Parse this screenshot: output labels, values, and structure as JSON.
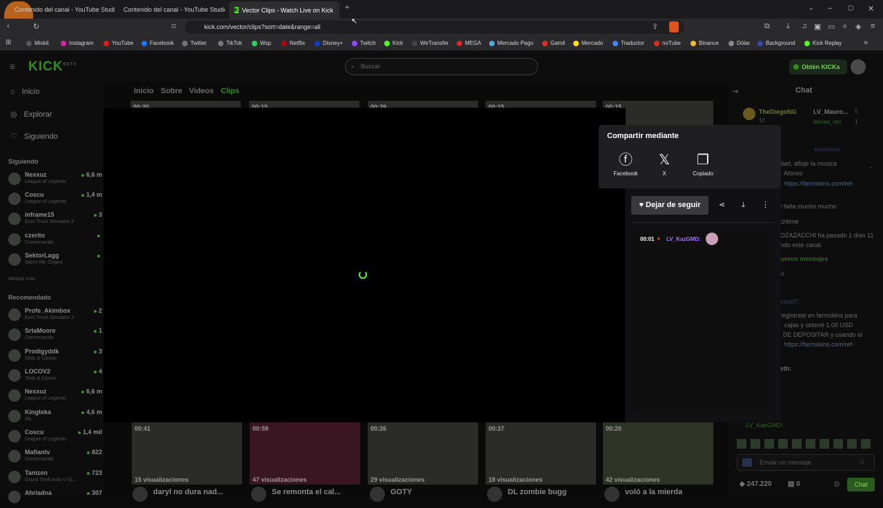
{
  "browser": {
    "tabs": [
      "Contenido del canal - YouTube Studio",
      "Contenido del canal - YouTube Studio",
      "Vector Clips - Watch Live on Kick"
    ],
    "url": "kick.com/vector/clips?sort=date&range=all",
    "bookmarks": [
      "Mixkit",
      "Instagram",
      "YouTube",
      "Facebook",
      "Twitter",
      "TikTok",
      "Wsp",
      "Netflix",
      "Disney+",
      "Twitch",
      "Kick",
      "WeTransfer",
      "MEGA",
      "Mercado Pago",
      "Gamil",
      "Mercado",
      "Traductor",
      "noTube",
      "Binance",
      "Dólar",
      "Background",
      "Kick Replay"
    ]
  },
  "header": {
    "logo": "KICK",
    "beta": "BETA",
    "search_placeholder": "Buscar",
    "kicks_button": "Obtén KICKs"
  },
  "sidebar": {
    "nav": [
      "Inicio",
      "Explorar",
      "Siguiendo"
    ],
    "following_title": "Siguiendo",
    "following": [
      {
        "name": "Nexxuz",
        "game": "League of Legends",
        "viewers": "6,6 m"
      },
      {
        "name": "Coscu",
        "game": "League of Legends",
        "viewers": "1,4 m"
      },
      {
        "name": "inframe15",
        "game": "Euro Truck Simulator 2",
        "viewers": "3"
      },
      {
        "name": "czerito",
        "game": "Conversando",
        "viewers": ""
      },
      {
        "name": "SektorLagg",
        "game": "Silent Hill: Origins",
        "viewers": ""
      }
    ],
    "show_more": "Mostrar más",
    "recommended_title": "Recomendado",
    "recommended": [
      {
        "name": "Profe_Akimbox",
        "game": "Euro Truck Simulator 2",
        "viewers": "2"
      },
      {
        "name": "SrtaMoore",
        "game": "Conversando",
        "viewers": "1"
      },
      {
        "name": "Prodigyddk",
        "game": "Slots & Casino",
        "viewers": "3"
      },
      {
        "name": "LOCOV2",
        "game": "Slots & Casino",
        "viewers": "4"
      },
      {
        "name": "Nexxuz",
        "game": "League of Legends",
        "viewers": "6,6 m"
      },
      {
        "name": "Kingteka",
        "game": "IRL",
        "viewers": "4,6 m"
      },
      {
        "name": "Coscu",
        "game": "League of Legends",
        "viewers": "1,4 mil"
      },
      {
        "name": "Mafiantv",
        "game": "Conversando",
        "viewers": "822"
      },
      {
        "name": "Tanizen",
        "game": "Grand Theft Auto V (G...",
        "viewers": "723"
      },
      {
        "name": "Ahriadna",
        "game": "",
        "viewers": "307"
      }
    ]
  },
  "page_tabs": [
    "Inicio",
    "Sobre",
    "Videos",
    "Clips"
  ],
  "top_clips": [
    "00:20",
    "00:15",
    "00:29",
    "00:15",
    "00:15"
  ],
  "bottom_clips": [
    {
      "duration": "00:41",
      "views": "15 visualizaciones",
      "title": "daryl no dura nad..."
    },
    {
      "duration": "00:59",
      "views": "47 visualizaciones",
      "title": "Se remonta el cal..."
    },
    {
      "duration": "00:26",
      "views": "29 visualizaciones",
      "title": "GOTY"
    },
    {
      "duration": "00:37",
      "views": "18 visualizaciones",
      "title": "DL zombie bugg"
    },
    {
      "duration": "00:20",
      "views": "42 visualizaciones",
      "title": "voló a la mierda"
    }
  ],
  "share": {
    "title": "Compartir mediante",
    "options": [
      "Facebook",
      "X",
      "Copiado"
    ]
  },
  "clip_actions": {
    "follow_label": "Dejar de seguir"
  },
  "clip_chat": {
    "time": "00:01",
    "user": "LV_KazGMD:"
  },
  "chat": {
    "title": "Chat",
    "top_users": [
      {
        "name": "TheDiegoNG",
        "count": "10"
      },
      {
        "name": "LV_Mauro...",
        "count": "5"
      },
      {
        "name": "lancaa_vpx",
        "count": "1"
      }
    ],
    "pinned_user": "BabyDiedo0",
    "lines": [
      "dad, afloje la musica",
      "Alonso",
      "https://farmskins.com/ref-",
      "r:falta mucho mucho",
      "chtime",
      "OZAZACCHI ha pasado 1 días 11",
      "ndo este canal.",
      "uevos mensajes",
      "u",
      "zsuel7:",
      "registrate en farmskins para",
      "cajas y obtené 1.00 USD",
      "DE DEPOSITAR y usando el",
      "https://farmskins.com/ref-",
      "eth:",
      "LV_KazGMD:"
    ],
    "input_placeholder": "Enviar un mensaje",
    "points": "247.220",
    "zero": "0",
    "send_label": "Chat"
  }
}
